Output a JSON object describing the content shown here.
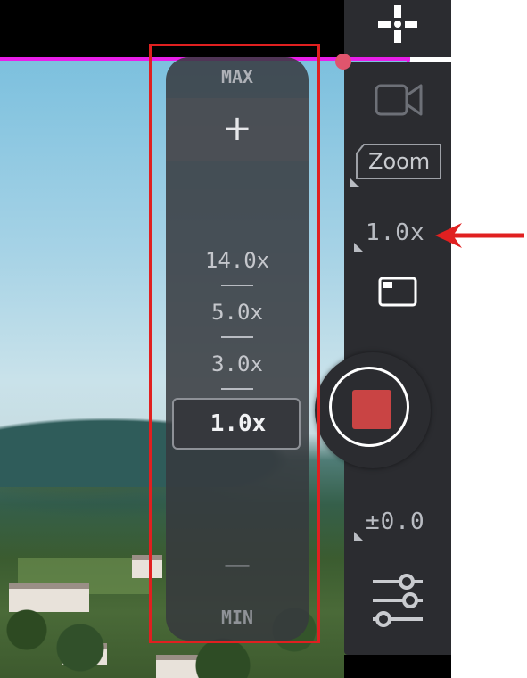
{
  "camera_ui": {
    "zoom_panel": {
      "max_label": "MAX",
      "plus_label": "+",
      "levels": [
        "14.0x",
        "5.0x",
        "3.0x"
      ],
      "selected_level": "1.0x",
      "minus_label": "—",
      "min_label": "MIN"
    },
    "sidebar": {
      "zoom_tab_label": "Zoom",
      "zoom_value": "1.0x",
      "exposure_value": "±0.0"
    },
    "icons": {
      "focus": "crosshair-icon",
      "camera": "video-camera-icon",
      "frame": "aspect-frame-icon",
      "record": "stop-record-icon",
      "settings": "sliders-icon"
    }
  },
  "annotations": {
    "highlight_color": "#e02020",
    "arrow_color": "#e02020"
  },
  "colors": {
    "panel": "#2b2c30",
    "guide_line": "#e81fe8",
    "record_stop": "#c94444"
  }
}
